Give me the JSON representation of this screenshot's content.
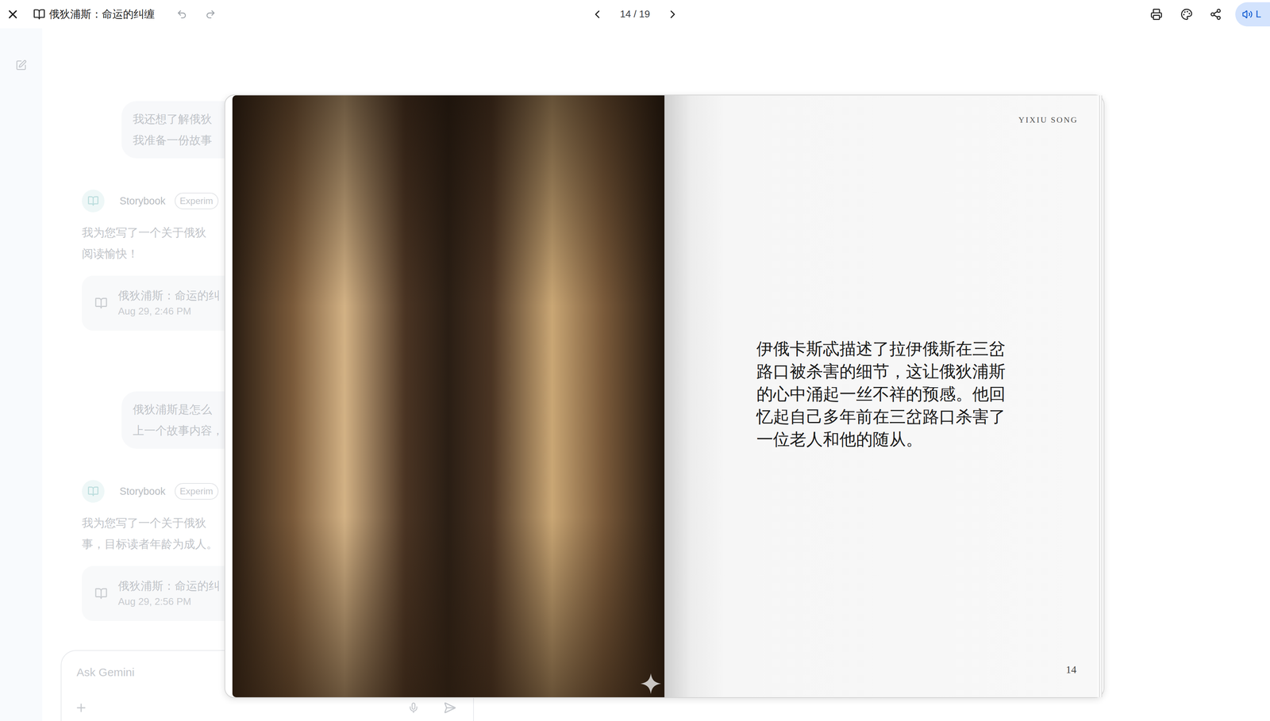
{
  "window": {
    "title": "俄狄浦斯：命运的纠缠"
  },
  "toolbar": {
    "page": "14 / 19",
    "listen": "L"
  },
  "chat": {
    "messages": [
      {
        "kind": "user",
        "lines": [
          "我还想了解俄狄",
          "我准备一份故事"
        ]
      },
      {
        "kind": "bot",
        "name": "Storybook",
        "badge": "Experim",
        "lines": [
          "我为您写了一个关于俄狄",
          "阅读愉快！"
        ],
        "card": {
          "title": "俄狄浦斯：命运的纠",
          "date": "Aug 29, 2:46 PM"
        }
      },
      {
        "kind": "user",
        "lines": [
          "俄狄浦斯是怎么",
          "上一个故事内容，"
        ]
      },
      {
        "kind": "bot",
        "name": "Storybook",
        "badge": "Experim",
        "lines": [
          "我为您写了一个关于俄狄",
          "事，目标读者年龄为成人。"
        ],
        "card": {
          "title": "俄狄浦斯：命运的纠",
          "date": "Aug 29, 2:56 PM"
        }
      }
    ],
    "input": {
      "placeholder": "Ask Gemini"
    }
  },
  "book": {
    "author": "YIXIU SONG",
    "text": "伊俄卡斯忒描述了拉伊俄斯在三岔路口被杀害的细节，这让俄狄浦斯的心中涌起一丝不祥的预感。他回忆起自己多年前在三岔路口杀害了一位老人和他的随从。",
    "page_number": "14"
  }
}
